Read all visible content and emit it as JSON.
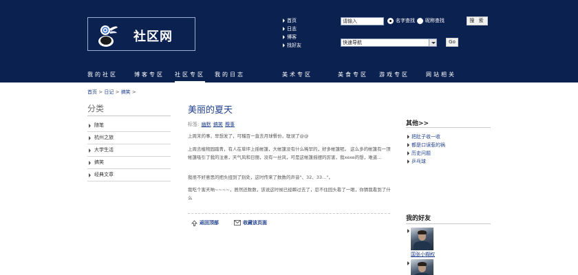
{
  "header": {
    "logo_text": "社区网",
    "quick_links": [
      "首页",
      "日志",
      "博客",
      "找好友"
    ],
    "search": {
      "input_value": "请输入",
      "radio_options": [
        {
          "label": "名字查找",
          "selected": true
        },
        {
          "label": "昵称查找",
          "selected": false
        }
      ],
      "button_label": "搜 索"
    },
    "quick_nav": {
      "selected": "快速导航",
      "go_label": "Go"
    },
    "nav": [
      {
        "label": "我的社区",
        "active": false
      },
      {
        "label": "博客专区",
        "active": false
      },
      {
        "label": "社区专区",
        "active": true
      },
      {
        "label": "我的日志",
        "active": false
      },
      {
        "label": "美术专区",
        "active": false
      },
      {
        "label": "美食专区",
        "active": false
      },
      {
        "label": "游戏专区",
        "active": false
      },
      {
        "label": "网站相关",
        "active": false
      }
    ],
    "colors": {
      "background": "#0b2150",
      "text": "#ffffff"
    }
  },
  "breadcrumb": {
    "items": [
      "首页",
      "日记",
      "搞笑"
    ],
    "separator": ">"
  },
  "sidebar": {
    "title": "分类",
    "items": [
      "随笔",
      "杭州之旅",
      "大学生活",
      "搞笑",
      "经典文章"
    ]
  },
  "article": {
    "title": "美丽的夏天",
    "tags_label": "标签:",
    "tags": [
      "幽默",
      "搞笑",
      "糗事"
    ],
    "paragraphs": [
      "上周末的事，早想发了，可稽百一直去月球餐份，耽误了@@",
      "上周去植物园踏青，有人在草坪上摇帐篷，大帐篷没有什么稀罕的，好多帐篷呢。 这么多的帐篷有一顶帐篷吸引了我的注意，天气风和日丽，没有一丝风，可是这帐篷摇摆的厉害，我xexe的想，难道...",
      "我很不好意思的把头扭到了别处，这时传来了数数的声音\"、32、33...\"，",
      "我吃个害天呐~~~~，居然还数数，该说这时候已经瞬过去了，忍不住回头看了一眼，你猜我看到了什么"
    ],
    "actions": [
      {
        "label": "返回顶部",
        "icon": "back-top-icon"
      },
      {
        "label": "收藏该页面",
        "icon": "envelope-icon"
      }
    ],
    "colors": {
      "title": "#1f3f8f",
      "link": "#1f3f8f"
    }
  },
  "right_sidebar": {
    "other_title": "其他>>",
    "other_items": [
      "把肚子收一收",
      "都是口误惹的祸",
      "历史问题",
      "乒乓球"
    ],
    "friends_title": "我的好友",
    "friends": [
      {
        "name": "国张小糊权"
      },
      {
        "name": ""
      }
    ]
  }
}
